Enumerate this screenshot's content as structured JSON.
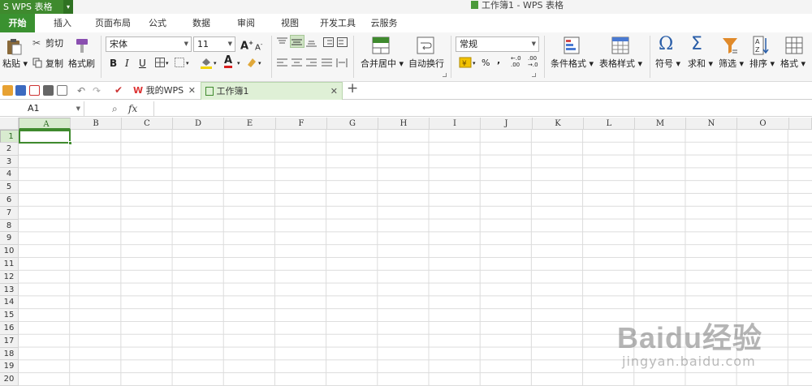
{
  "app": {
    "name": "WPS 表格",
    "window_title": "工作簿1 - WPS 表格"
  },
  "ribbon_tabs": [
    "开始",
    "插入",
    "页面布局",
    "公式",
    "数据",
    "审阅",
    "视图",
    "开发工具",
    "云服务"
  ],
  "ribbon": {
    "paste": "粘贴",
    "cut": "剪切",
    "copy": "复制",
    "format_painter": "格式刷",
    "font_name": "宋体",
    "font_size": "11",
    "bold": "B",
    "italic": "I",
    "underline": "U",
    "font_color_glyph": "A",
    "font_grow": "A",
    "font_shrink": "A",
    "merge_center": "合并居中",
    "wrap_text": "自动换行",
    "number_format": "常规",
    "percent": "%",
    "comma": ",",
    "conditional_format": "条件格式",
    "table_style": "表格样式",
    "symbol": "符号",
    "sum": "求和",
    "filter": "筛选",
    "sort": "排序",
    "format": "格式",
    "omega": "Ω",
    "sigma": "Σ"
  },
  "doc_tabs": [
    {
      "label": "我的WPS",
      "active": false
    },
    {
      "label": "工作簿1",
      "active": true
    }
  ],
  "formula_bar": {
    "name_box": "A1",
    "fx": "fx",
    "value": ""
  },
  "sheet": {
    "columns": [
      "A",
      "B",
      "C",
      "D",
      "E",
      "F",
      "G",
      "H",
      "I",
      "J",
      "K",
      "L",
      "M",
      "N",
      "O"
    ],
    "rows": [
      "1",
      "2",
      "3",
      "4",
      "5",
      "6",
      "7",
      "8",
      "9",
      "10",
      "11",
      "12",
      "13",
      "14",
      "15",
      "16",
      "17",
      "18",
      "19",
      "20"
    ],
    "selected_cell": "A1"
  },
  "watermark": {
    "brand": "Baidu经验",
    "url": "jingyan.baidu.com"
  },
  "colors": {
    "accent": "#3f8a2e",
    "selected_header": "#d8ebcf"
  }
}
